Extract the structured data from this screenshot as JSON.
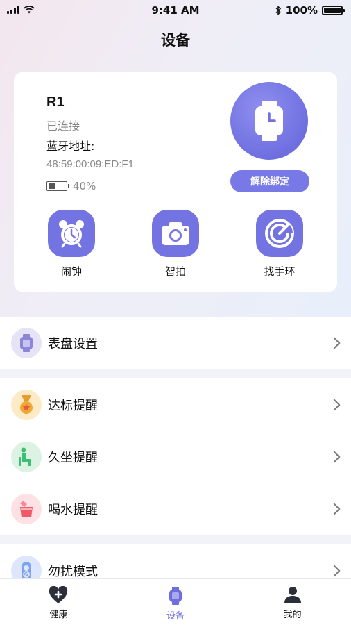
{
  "status_bar": {
    "time": "9:41 AM",
    "battery_percent": "100%",
    "battery_level": 1.0
  },
  "page_title": "设备",
  "device": {
    "name": "R1",
    "status": "已连接",
    "bluetooth_label": "蓝牙地址:",
    "bluetooth_address": "48:59:00:09:ED:F1",
    "battery_text": "40%",
    "battery_level": 0.4,
    "unbind_label": "解除绑定"
  },
  "actions": [
    {
      "label": "闹钟",
      "icon": "alarm-clock-icon"
    },
    {
      "label": "智拍",
      "icon": "camera-icon"
    },
    {
      "label": "找手环",
      "icon": "find-band-icon"
    }
  ],
  "menu": {
    "watch_face": {
      "label": "表盘设置",
      "icon": "watch-face-icon",
      "color": "#e6e3f7"
    },
    "goal": {
      "label": "达标提醒",
      "icon": "medal-icon",
      "color": "#fdebc8"
    },
    "sedentary": {
      "label": "久坐提醒",
      "icon": "sitting-person-icon",
      "color": "#dcf3e4"
    },
    "drink": {
      "label": "喝水提醒",
      "icon": "water-cup-icon",
      "color": "#fde1e4"
    },
    "dnd": {
      "label": "勿扰模式",
      "icon": "do-not-disturb-icon",
      "color": "#dde6fb"
    }
  },
  "tabs": [
    {
      "label": "健康",
      "icon": "heart-plus-icon",
      "active": false
    },
    {
      "label": "设备",
      "icon": "watch-icon",
      "active": true
    },
    {
      "label": "我的",
      "icon": "person-icon",
      "active": false
    }
  ],
  "colors": {
    "accent": "#6e6edd",
    "page_bg": "#f2f3f8"
  }
}
